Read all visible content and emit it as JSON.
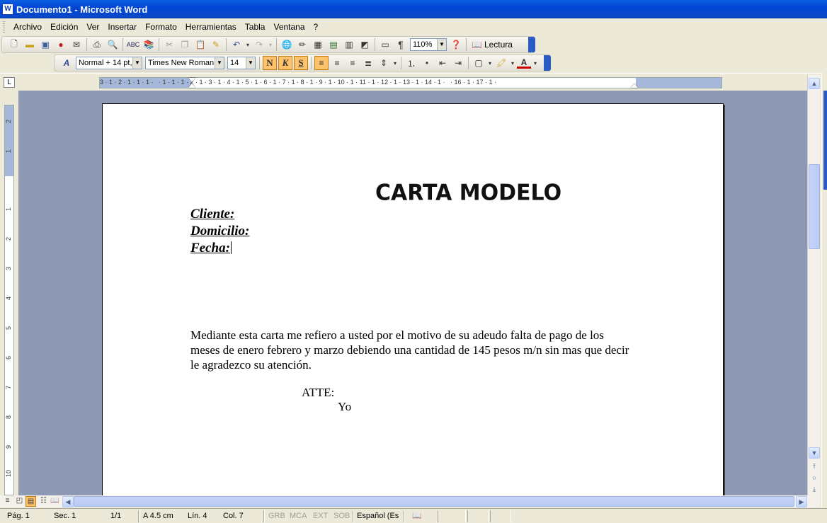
{
  "window": {
    "title": "Documento1 - Microsoft Word",
    "app_icon": "W"
  },
  "menu": [
    {
      "label": "Archivo",
      "key": "A"
    },
    {
      "label": "Edición",
      "key": "E"
    },
    {
      "label": "Ver",
      "key": "V"
    },
    {
      "label": "Insertar",
      "key": "I"
    },
    {
      "label": "Formato",
      "key": "F"
    },
    {
      "label": "Herramientas",
      "key": "H"
    },
    {
      "label": "Tabla",
      "key": "a"
    },
    {
      "label": "Ventana",
      "key": "n"
    },
    {
      "label": "?",
      "key": "?"
    }
  ],
  "standard_toolbar": {
    "zoom": "110%",
    "show_marks_glyph": "¶",
    "reading_label": "Lectura"
  },
  "format_toolbar": {
    "style": "Normal + 14 pt,",
    "font": "Times New Roman",
    "size": "14",
    "bold": "N",
    "italic": "K",
    "underline": "S"
  },
  "ruler": {
    "numbers": "3 · 1 · 2 · 1 · 1 · 1 ·   · 1 · 1 · 1 · 2 · 1 · 3 · 1 · 4 · 1 · 5 · 1 · 6 · 1 · 7 · 1 · 8 · 1 · 9 · 1 · 10 · 1 · 11 · 1 · 12 · 1 · 13 · 1 · 14 · 1 ·   · 16 · 1 · 17 · 1 ·"
  },
  "vertical_ruler": [
    "2",
    "1",
    "1",
    "2",
    "3",
    "4",
    "5",
    "6",
    "7",
    "8",
    "9",
    "10"
  ],
  "document": {
    "title": "CARTA MODELO",
    "fields": [
      "Cliente:",
      "Domicilio:",
      "Fecha:"
    ],
    "body": "Mediante esta carta me refiero a usted por el motivo de su adeudo  falta de pago de los meses de enero febrero y marzo debiendo una cantidad de 145 pesos m/n sin mas que decir le agradezco su atención.",
    "closing": "ATTE:",
    "signature": "Yo"
  },
  "status": {
    "page": "Pág. 1",
    "section": "Sec. 1",
    "pages": "1/1",
    "at": "A  4.5 cm",
    "line": "Lín. 4",
    "col": "Col. 7",
    "grb": "GRB",
    "mca": "MCA",
    "ext": "EXT",
    "sob": "SOB",
    "language": "Español (Es"
  }
}
